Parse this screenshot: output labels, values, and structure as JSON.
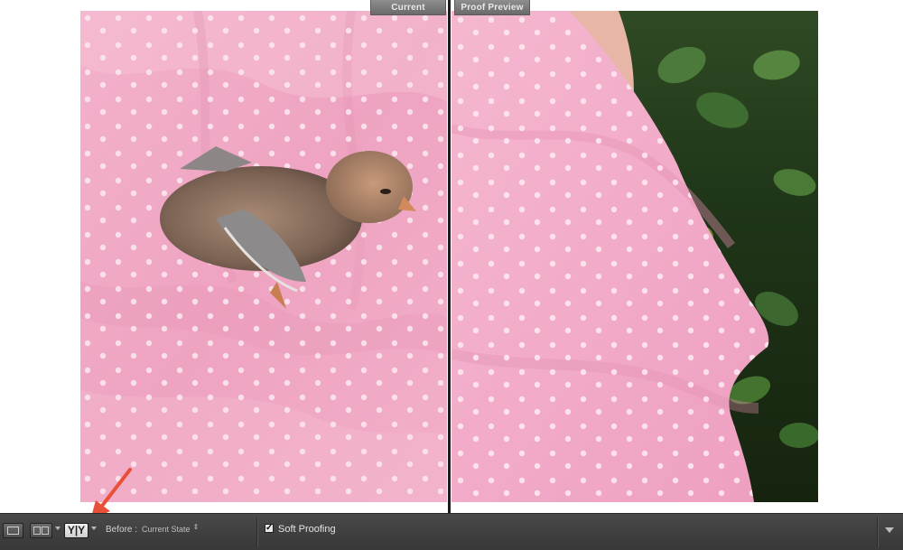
{
  "view": {
    "before_label": "Current",
    "after_label": "Proof Preview"
  },
  "toolbar": {
    "loupe_icon": "loupe-view-icon",
    "compare_icon": "before-after-icon",
    "yy_icon": "before-after-split-icon",
    "before_label": "Before :",
    "before_value": "Current State",
    "before_stepper": "⇕",
    "soft_proofing_checked": true,
    "soft_proofing_label": "Soft Proofing",
    "toolbar_menu_icon": "chevron-down-icon"
  },
  "colors": {
    "toolbar_bg": "#3e3e3e",
    "annotation_arrow": "#e8503a",
    "dress_pink": "#f0a9c6"
  }
}
